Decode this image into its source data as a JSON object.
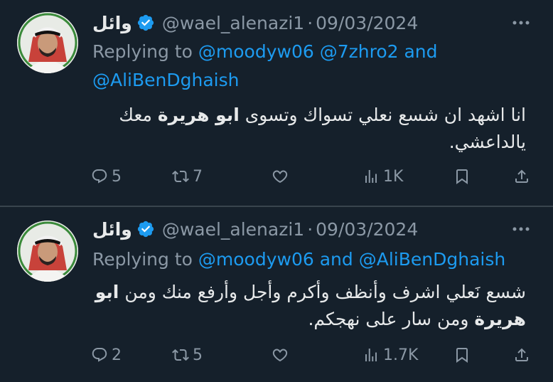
{
  "tweets": [
    {
      "name": "وائل",
      "handle": "@wael_alenazi1",
      "separator": "·",
      "date": "09/03/2024",
      "replying_to_prefix": "Replying to",
      "mentions_line1": "@moodyw06 @7zhro2",
      "and_word": "and",
      "mentions_line2": "@AliBenDghaish",
      "text_before_bold": "انا اشهد ان شسع نعلي تسواك وتسوى ",
      "text_bold": "ابو هريرة",
      "text_after_bold": " معك يالداعشي.",
      "replies": "5",
      "reposts": "7",
      "likes": "",
      "views": "1K"
    },
    {
      "name": "وائل",
      "handle": "@wael_alenazi1",
      "separator": "·",
      "date": "09/03/2024",
      "replying_to_prefix": "Replying to",
      "mention_a": "@moodyw06",
      "and_word": "and",
      "mention_b": "@AliBenDghaish",
      "text_before_bold": "شسع نَعلي اشرف وأنظف وأكرم وأجل وأرفع منك ومن ",
      "text_bold": "ابو هريرة",
      "text_after_bold": " ومن سار على نهجكم.",
      "replies": "2",
      "reposts": "5",
      "likes": "",
      "views": "1.7K"
    }
  ],
  "colors": {
    "background": "#15202b",
    "text": "#e7e9ea",
    "muted": "#8b98a5",
    "link": "#1d9bf0",
    "divider": "#38444d"
  },
  "icons": [
    "verified-badge-icon",
    "more-icon",
    "reply-icon",
    "repost-icon",
    "like-icon",
    "views-icon",
    "bookmark-icon",
    "share-icon"
  ]
}
